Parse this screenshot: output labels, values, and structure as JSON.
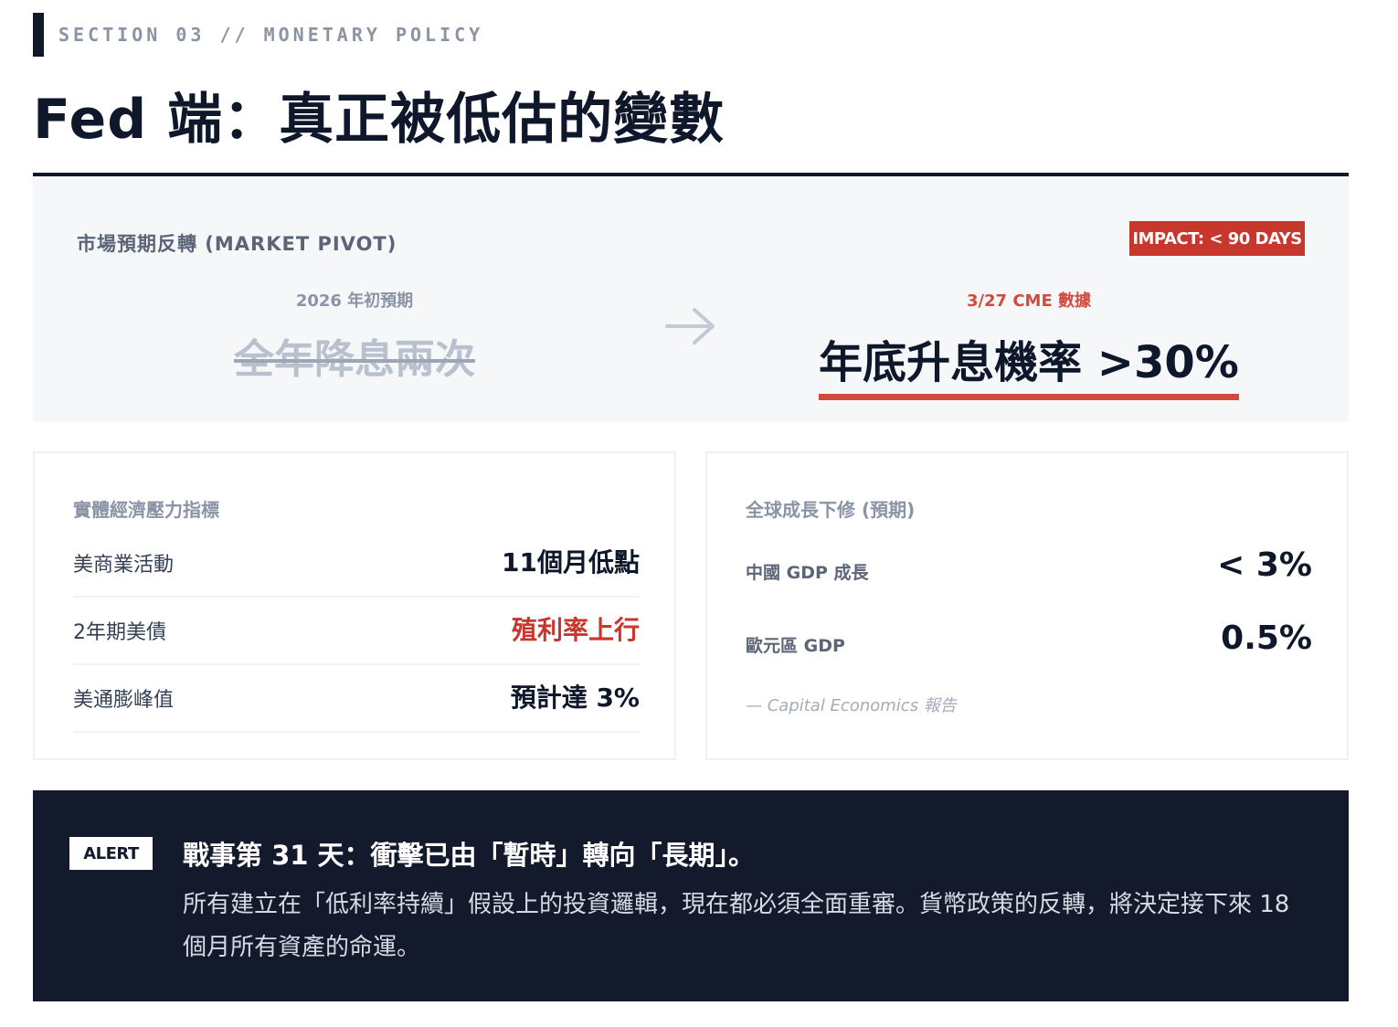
{
  "header": {
    "section_label": "SECTION 03 // MONETARY POLICY",
    "title": "Fed 端：真正被低估的變數"
  },
  "pivot": {
    "heading": "市場預期反轉 (MARKET PIVOT)",
    "impact_badge": "IMPACT: < 90 DAYS",
    "before": {
      "sub": "2026 年初預期",
      "value": "全年降息兩次"
    },
    "arrow_icon": "arrow-right-icon",
    "after": {
      "sub": "3/27 CME 數據",
      "value": "年底升息機率 >30%"
    }
  },
  "indicators": {
    "heading": "實體經濟壓力指標",
    "rows": [
      {
        "label": "美商業活動",
        "value": "11個月低點",
        "highlight": false
      },
      {
        "label": "2年期美債",
        "value": "殖利率上行",
        "highlight": true
      },
      {
        "label": "美通膨峰值",
        "value": "預計達 3%",
        "highlight": false
      }
    ]
  },
  "growth": {
    "heading": "全球成長下修 (預期)",
    "rows": [
      {
        "label": "中國 GDP 成長",
        "value": "< 3%"
      },
      {
        "label": "歐元區 GDP",
        "value": "0.5%"
      }
    ],
    "source": "— Capital Economics 報告"
  },
  "alert": {
    "badge": "ALERT",
    "title": "戰事第 31 天：衝擊已由「暫時」轉向「長期」。",
    "body": "所有建立在「低利率持續」假設上的投資邏輯，現在都必須全面重審。貨幣政策的反轉，將決定接下來 18 個月所有資產的命運。"
  },
  "colors": {
    "accent_red": "#c8372d",
    "dark_navy": "#121a2c",
    "muted_gray": "#8a94a6"
  }
}
